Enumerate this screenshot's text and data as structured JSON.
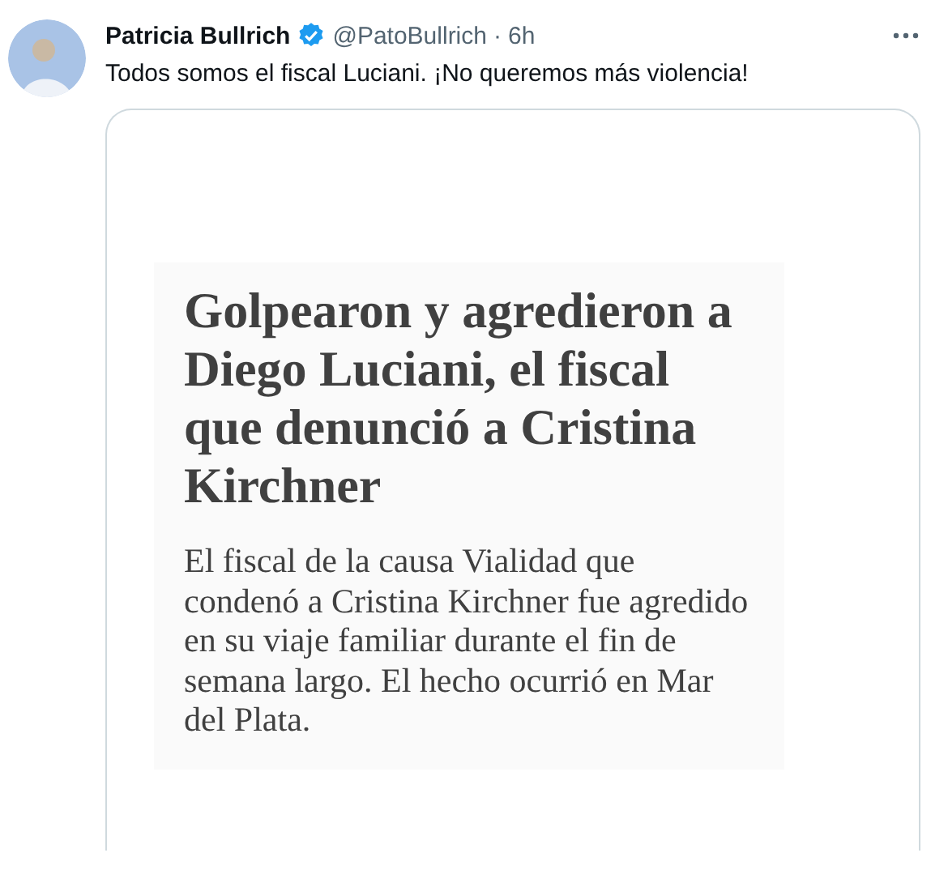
{
  "tweet": {
    "author": {
      "name": "Patricia Bullrich",
      "verified": true,
      "handle": "@PatoBullrich",
      "separator": "·",
      "time": "6h"
    },
    "text": "Todos somos el fiscal Luciani. ¡No queremos más violencia!",
    "media": {
      "headline": "Golpearon y agredieron a Diego Luciani, el fiscal que denunció a Cristina Kirchner",
      "summary": "El fiscal de la causa Vialidad que condenó a Cristina Kirchner fue agredido en su viaje familiar durante el fin de semana largo. El hecho ocurrió en Mar del Plata."
    }
  }
}
